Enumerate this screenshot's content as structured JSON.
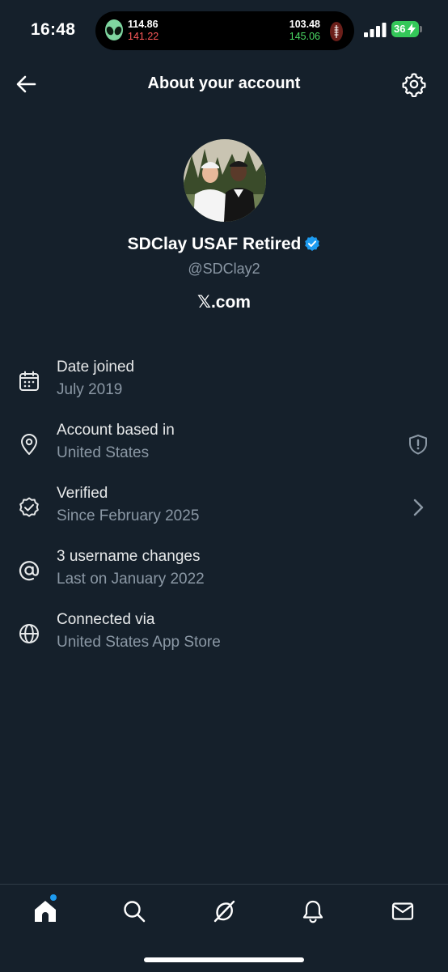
{
  "status_bar": {
    "time": "16:48",
    "live_activity": {
      "left_top": "114.86",
      "left_bottom": "141.22",
      "right_top": "103.48",
      "right_bottom": "145.06"
    },
    "battery": "36"
  },
  "header": {
    "title": "About your account"
  },
  "profile": {
    "display_name": "SDClay USAF Retired",
    "handle": "@SDClay2",
    "site": "𝕏.com"
  },
  "rows": [
    {
      "title": "Date joined",
      "subtitle": "July 2019",
      "icon": "calendar-icon"
    },
    {
      "title": "Account based in",
      "subtitle": "United States",
      "icon": "location-pin-icon",
      "trailing_icon": "shield-alert-icon"
    },
    {
      "title": "Verified",
      "subtitle": "Since February 2025",
      "icon": "verified-badge-icon",
      "trailing_icon": "chevron-right-icon"
    },
    {
      "title": "3 username changes",
      "subtitle": "Last on January 2022",
      "icon": "at-sign-icon"
    },
    {
      "title": "Connected via",
      "subtitle": "United States App Store",
      "icon": "globe-icon"
    }
  ],
  "bottom_nav": [
    "home-icon",
    "search-icon",
    "grok-icon",
    "notifications-icon",
    "messages-icon"
  ],
  "colors": {
    "background": "#15202b",
    "secondary_text": "#8b98a5",
    "accent": "#1d9bf0",
    "battery": "#34c759"
  }
}
